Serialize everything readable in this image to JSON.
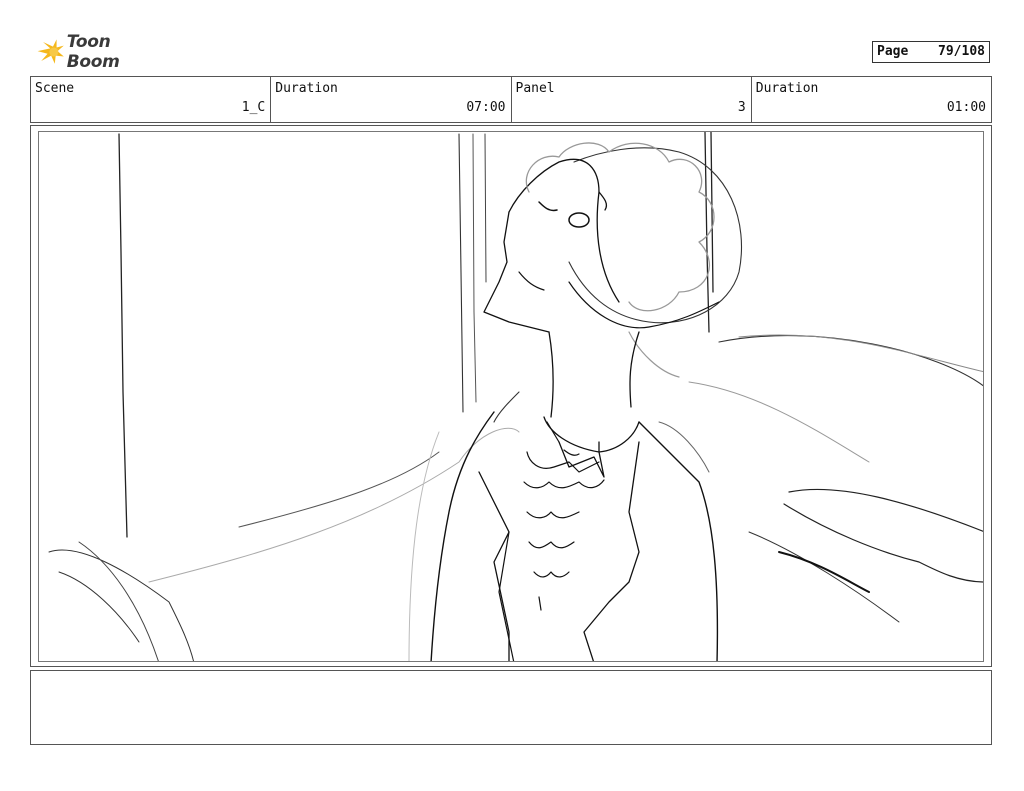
{
  "brand": {
    "logo_text": "Toon Boom",
    "logo_color": "#f5b81c"
  },
  "page": {
    "label": "Page",
    "value": "79/108"
  },
  "header": {
    "scene_label": "Scene",
    "scene_value": "1_C",
    "scene_duration_label": "Duration",
    "scene_duration_value": "07:00",
    "panel_label": "Panel",
    "panel_value": "3",
    "panel_duration_label": "Duration",
    "panel_duration_value": "01:00"
  },
  "notes": {
    "text": ""
  }
}
